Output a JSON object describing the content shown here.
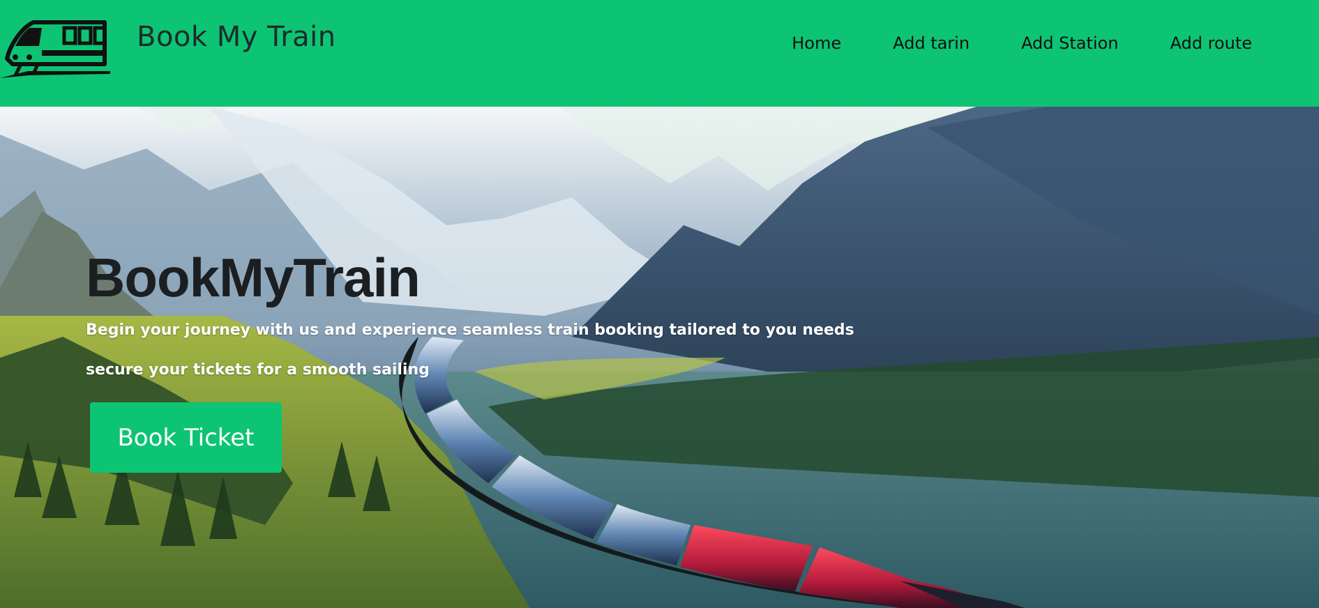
{
  "brand": {
    "title": "Book My Train",
    "logo_icon": "train-icon"
  },
  "nav": {
    "items": [
      {
        "label": "Home"
      },
      {
        "label": "Add tarin"
      },
      {
        "label": "Add Station"
      },
      {
        "label": "Add route"
      }
    ]
  },
  "hero": {
    "title": "BookMyTrain",
    "line1": "Begin your journey with us and experience seamless train booking tailored to you needs",
    "line2": "secure your tickets for a smooth sailing",
    "cta_label": "Book Ticket"
  },
  "colors": {
    "accent": "#0dc474",
    "title_text": "#1b1f22",
    "subtitle_text": "#ffffff"
  }
}
